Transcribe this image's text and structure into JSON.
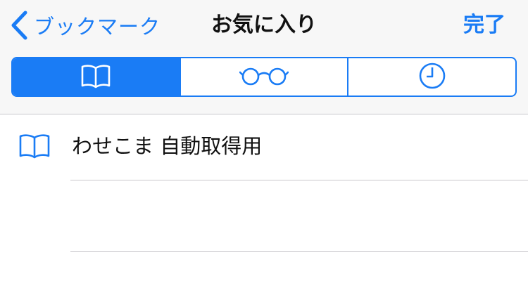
{
  "nav": {
    "back_label": "ブックマーク",
    "title": "お気に入り",
    "done_label": "完了"
  },
  "segments": [
    {
      "icon": "book-icon",
      "selected": true
    },
    {
      "icon": "reading-glasses-icon",
      "selected": false
    },
    {
      "icon": "clock-icon",
      "selected": false
    }
  ],
  "list": {
    "items": [
      {
        "icon": "book-icon",
        "label": "わせこま 自動取得用"
      },
      {
        "icon": "",
        "label": ""
      }
    ]
  },
  "colors": {
    "accent": "#1a7cf5",
    "header_bg": "#f7f7f7",
    "separator": "#c8c7cc",
    "text": "#111111"
  }
}
